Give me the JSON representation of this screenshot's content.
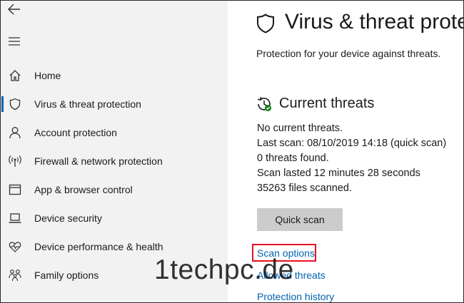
{
  "sidebar": {
    "items": [
      {
        "label": "Home",
        "icon": "home-icon",
        "active": false
      },
      {
        "label": "Virus & threat protection",
        "icon": "shield-icon",
        "active": true
      },
      {
        "label": "Account protection",
        "icon": "person-icon",
        "active": false
      },
      {
        "label": "Firewall & network protection",
        "icon": "wifi-antenna-icon",
        "active": false
      },
      {
        "label": "App & browser control",
        "icon": "browser-window-icon",
        "active": false
      },
      {
        "label": "Device security",
        "icon": "laptop-icon",
        "active": false
      },
      {
        "label": "Device performance & health",
        "icon": "heart-pulse-icon",
        "active": false
      },
      {
        "label": "Family options",
        "icon": "family-icon",
        "active": false
      }
    ]
  },
  "main": {
    "title": "Virus & threat protection",
    "subtitle": "Protection for your device against threats.",
    "current_threats": {
      "heading": "Current threats",
      "lines": [
        "No current threats.",
        "Last scan: 08/10/2019 14:18 (quick scan)",
        "0 threats found.",
        "Scan lasted 12 minutes 28 seconds",
        "35263 files scanned."
      ],
      "quick_scan_label": "Quick scan"
    },
    "links": {
      "scan_options": "Scan options",
      "allowed_threats": "Allowed threats",
      "protection_history": "Protection history"
    }
  },
  "watermark": "1techpc.de",
  "colors": {
    "accent": "#0063b1",
    "sidebar_bg": "#f2f2f2",
    "button_bg": "#cccccc",
    "highlight_box": "#e81123",
    "status_ok": "#107c10"
  }
}
